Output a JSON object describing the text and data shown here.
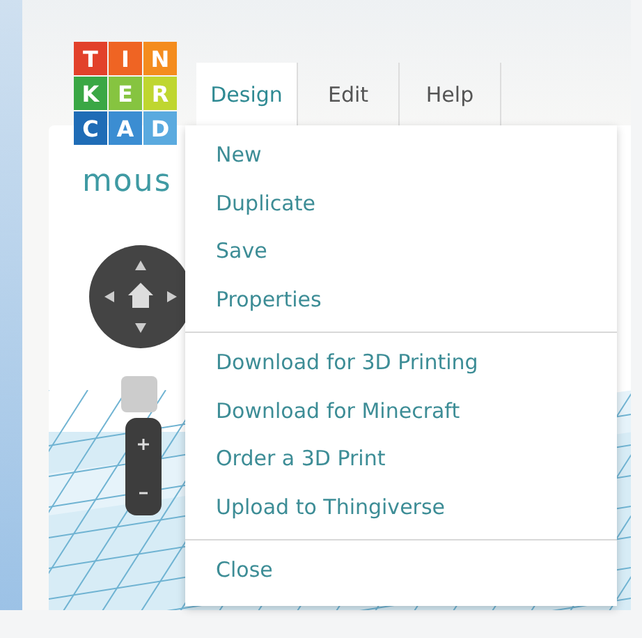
{
  "logo": {
    "letters": [
      {
        "text": "T",
        "color": "#e2412b"
      },
      {
        "text": "I",
        "color": "#ef6423"
      },
      {
        "text": "N",
        "color": "#f48c1e"
      },
      {
        "text": "K",
        "color": "#3aa745"
      },
      {
        "text": "E",
        "color": "#86c440"
      },
      {
        "text": "R",
        "color": "#bfd630"
      },
      {
        "text": "C",
        "color": "#1f6cb6"
      },
      {
        "text": "A",
        "color": "#3b8dd2"
      },
      {
        "text": "D",
        "color": "#5aaadf"
      }
    ]
  },
  "tabs": [
    {
      "label": "Design",
      "selected": true
    },
    {
      "label": "Edit",
      "selected": false
    },
    {
      "label": "Help",
      "selected": false
    }
  ],
  "design_title": "mous",
  "menu": {
    "sections": [
      {
        "items": [
          "New",
          "Duplicate",
          "Save",
          "Properties"
        ]
      },
      {
        "items": [
          "Download for 3D Printing",
          "Download for Minecraft",
          "Order a 3D Print",
          "Upload to Thingiverse"
        ]
      },
      {
        "items": [
          "Close"
        ]
      }
    ]
  }
}
